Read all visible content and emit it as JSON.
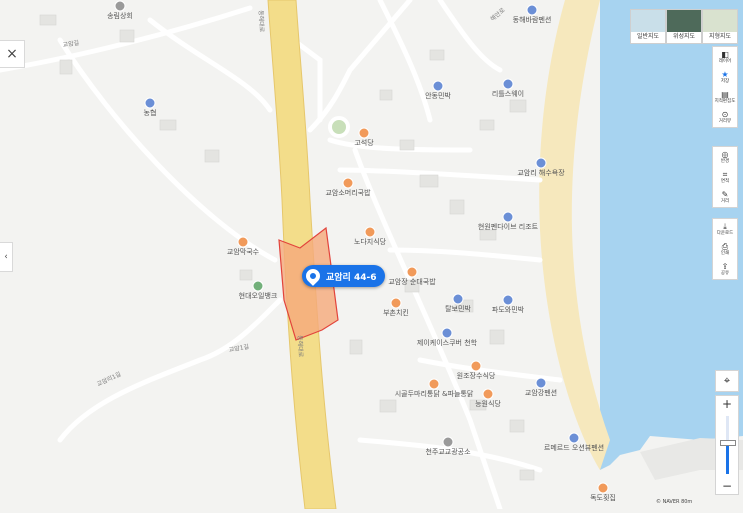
{
  "map": {
    "parcel_label": "교암리 44-6",
    "road_names": [
      "동해대로",
      "동해대로",
      "교암1길",
      "교암리1길",
      "교암길",
      "해안로"
    ],
    "colors": {
      "background": "#f3f3f1",
      "sea": "#a7d3f0",
      "beach": "#f6e8bd",
      "highway": "#f3dd8a",
      "parcel_fill": "#f5a97b",
      "parcel_stroke": "#e2443c",
      "pin": "#1a73e8"
    },
    "pois": [
      {
        "name": "송림상회",
        "kind": "gray"
      },
      {
        "name": "동해바람펜션",
        "kind": "blue"
      },
      {
        "name": "농협",
        "kind": "blue"
      },
      {
        "name": "안동민박",
        "kind": "blue"
      },
      {
        "name": "리틀스웨이",
        "kind": "blue"
      },
      {
        "name": "고석당",
        "kind": "food"
      },
      {
        "name": "교암소머리국밥",
        "kind": "food"
      },
      {
        "name": "교암리 해수욕장",
        "kind": "blue"
      },
      {
        "name": "현원펜다이브 리조트",
        "kind": "blue"
      },
      {
        "name": "노다지식당",
        "kind": "food"
      },
      {
        "name": "교암막국수",
        "kind": "food"
      },
      {
        "name": "현대오일뱅크",
        "kind": "green"
      },
      {
        "name": "교암장 순대국밥",
        "kind": "food"
      },
      {
        "name": "부촌치킨",
        "kind": "food"
      },
      {
        "name": "탈보민박",
        "kind": "blue"
      },
      {
        "name": "파도와민박",
        "kind": "blue"
      },
      {
        "name": "제이케이스쿠버 천학",
        "kind": "blue"
      },
      {
        "name": "원조장수식당",
        "kind": "food"
      },
      {
        "name": "시골두마리통닭 &파늘통닭",
        "kind": "food"
      },
      {
        "name": "능원식당",
        "kind": "food"
      },
      {
        "name": "교암강펜션",
        "kind": "blue"
      },
      {
        "name": "르메르드 오션뷰펜션",
        "kind": "blue"
      },
      {
        "name": "천주교교광공소",
        "kind": "gray"
      },
      {
        "name": "독도횟집",
        "kind": "food"
      }
    ]
  },
  "ui": {
    "close_label": "×",
    "handle_label": "‹",
    "map_types": [
      {
        "label": "일반지도",
        "thumb_color": "#c9dfe9"
      },
      {
        "label": "위성지도",
        "thumb_color": "#4e6a5a"
      },
      {
        "label": "지형지도",
        "thumb_color": "#d9e2cf"
      }
    ],
    "tools_group1": [
      {
        "icon": "layers-icon",
        "glyph": "◧",
        "label": "레이어"
      },
      {
        "icon": "star-icon",
        "glyph": "★",
        "label": "저장"
      },
      {
        "icon": "map-share-icon",
        "glyph": "▤",
        "label": "지적편집도"
      },
      {
        "icon": "street-view-icon",
        "glyph": "⊙",
        "label": "거리뷰"
      }
    ],
    "tools_group2": [
      {
        "icon": "radius-icon",
        "glyph": "◎",
        "label": "반경"
      },
      {
        "icon": "area-icon",
        "glyph": "⌗",
        "label": "면적"
      },
      {
        "icon": "distance-icon",
        "glyph": "✎",
        "label": "거리"
      }
    ],
    "tools_group3": [
      {
        "icon": "download-icon",
        "glyph": "⤓",
        "label": "다운로드"
      },
      {
        "icon": "print-icon",
        "glyph": "⎙",
        "label": "인쇄"
      },
      {
        "icon": "share-icon",
        "glyph": "⇪",
        "label": "공유"
      }
    ],
    "locate_glyph": "⌖",
    "zoom_in": "+",
    "zoom_out": "−",
    "zoom_level_fraction": 0.55,
    "scale_text": "© NAVER  80m"
  }
}
